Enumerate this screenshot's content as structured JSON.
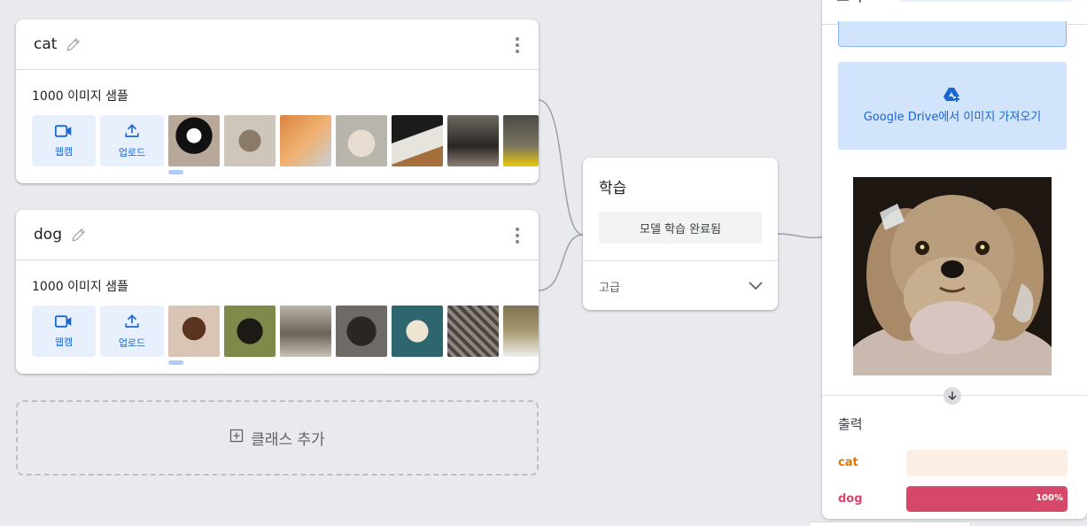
{
  "classes": [
    {
      "name": "cat",
      "samples": "1000 이미지 샘플",
      "webcam": "웹캠",
      "upload": "업로드"
    },
    {
      "name": "dog",
      "samples": "1000 이미지 샘플",
      "webcam": "웹캠",
      "upload": "업로드"
    }
  ],
  "add_class": "클래스 추가",
  "training": {
    "title": "학습",
    "button": "모델 학습 완료됨",
    "advanced": "고급"
  },
  "preview": {
    "top_label": "포기",
    "drive_button": "Google Drive에서 이미지 가져오기",
    "output_title": "출력",
    "outputs": [
      {
        "label": "cat",
        "value": 0,
        "value_text": "",
        "color": "#e37400",
        "track": "#fdeee4"
      },
      {
        "label": "dog",
        "value": 100,
        "value_text": "100%",
        "color": "#d6486a",
        "track": "#fce4ec"
      }
    ]
  },
  "colors": {
    "accent": "#1967d2",
    "button_bg": "#e8f0fe",
    "drive_bg": "#d2e3fc"
  }
}
